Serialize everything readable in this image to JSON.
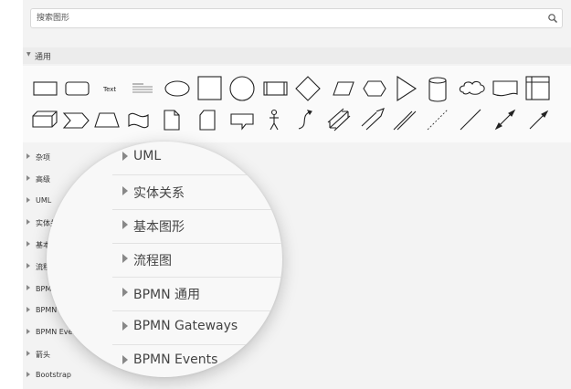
{
  "search": {
    "placeholder": "搜索图形"
  },
  "general": {
    "label": "通用",
    "expanded": true
  },
  "shapes": {
    "text_label": "Text",
    "items": [
      "rectangle",
      "rounded-rectangle",
      "text",
      "textbox",
      "ellipse",
      "square",
      "circle",
      "process",
      "diamond",
      "parallelogram",
      "hexagon",
      "triangle",
      "cylinder",
      "cloud",
      "document",
      "internal-storage",
      "cube",
      "step",
      "trapezoid",
      "tape",
      "note",
      "card",
      "callout",
      "actor",
      "curve",
      "bidirectional-arrow",
      "arrow",
      "link",
      "dashed-line",
      "line",
      "bidirectional-connector",
      "directional-connector"
    ]
  },
  "categories": [
    "杂项",
    "高级",
    "UML",
    "实体关系",
    "基本图形",
    "流程图",
    "BPMN 通用",
    "BPMN Gateways",
    "BPMN Events",
    "箭头",
    "Bootstrap"
  ],
  "magnifier": {
    "items": [
      "UML",
      "实体关系",
      "基本图形",
      "流程图",
      "BPMN 通用",
      "BPMN Gateways",
      "BPMN Events"
    ]
  }
}
